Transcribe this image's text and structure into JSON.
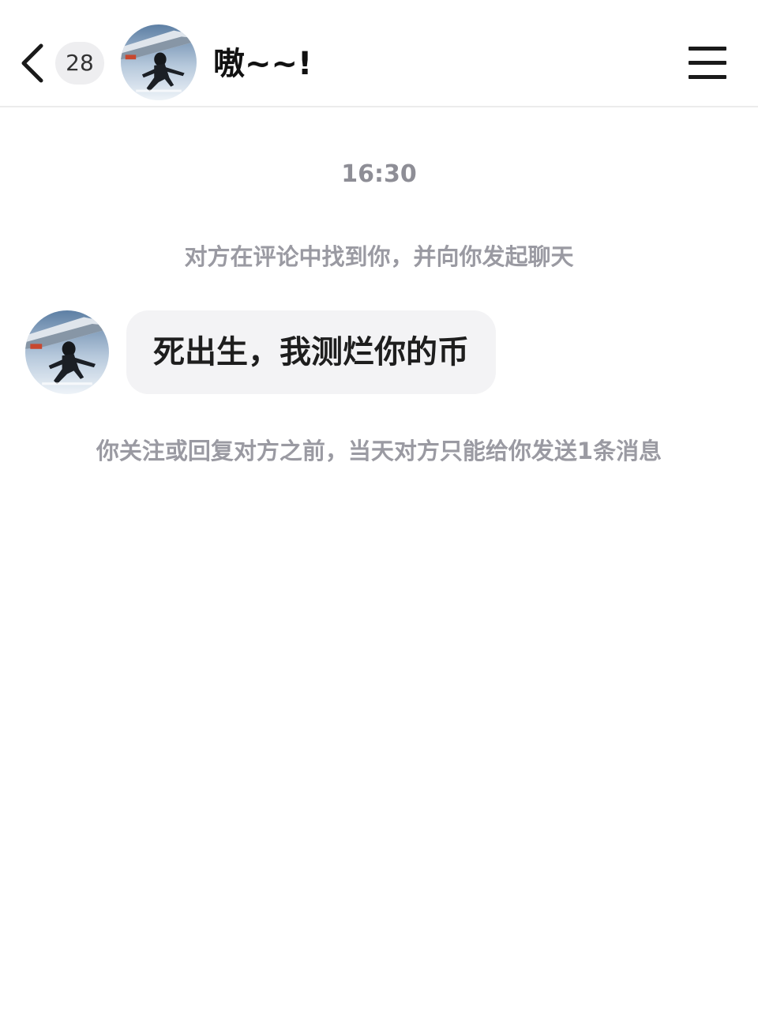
{
  "header": {
    "back_icon": "chevron-left-icon",
    "unread_count": "28",
    "contact_name": "嗷~~!",
    "menu_icon": "hamburger-menu-icon",
    "avatar_description": "skydiver-astronaut-avatar"
  },
  "chat": {
    "timestamp": "16:30",
    "system_note_intro": "对方在评论中找到你，并向你发起聊天",
    "messages": [
      {
        "sender": "contact",
        "text": "死出生，我测烂你的币"
      }
    ],
    "system_note_limit": "你关注或回复对方之前，当天对方只能给你发送1条消息"
  },
  "colors": {
    "bubble_background": "#f3f3f5",
    "system_text": "#9a9aa2",
    "header_divider": "#ececec"
  }
}
